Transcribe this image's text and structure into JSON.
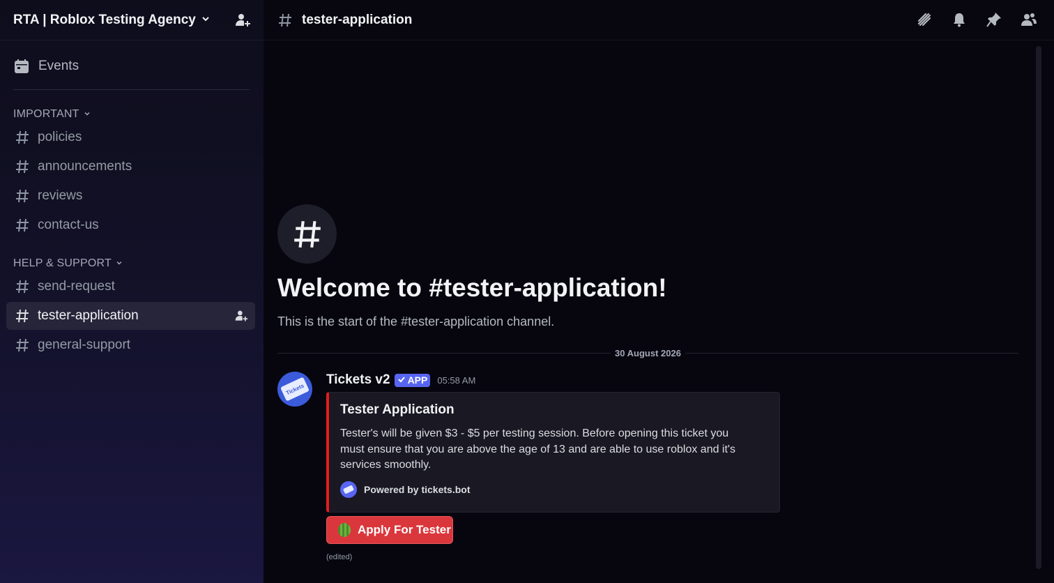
{
  "server": {
    "name": "RTA | Roblox Testing Agency"
  },
  "sidebar": {
    "events_label": "Events",
    "categories": [
      {
        "label": "IMPORTANT",
        "channels": [
          "policies",
          "announcements",
          "reviews",
          "contact-us"
        ]
      },
      {
        "label": "HELP & SUPPORT",
        "channels": [
          "send-request",
          "tester-application",
          "general-support"
        ]
      }
    ],
    "active_channel": "tester-application"
  },
  "topbar": {
    "channel_name": "tester-application",
    "icons": [
      "threads-icon",
      "bell-icon",
      "pin-icon",
      "member-list-icon"
    ]
  },
  "welcome": {
    "title": "Welcome to #tester-application!",
    "subtitle": "This is the start of the #tester-application channel."
  },
  "date_divider": "30 August 2026",
  "message": {
    "author": "Tickets v2",
    "badge": "APP",
    "timestamp": "05:58 AM",
    "avatar_text": "Tickets",
    "embed": {
      "accent_color": "#e01e1e",
      "title": "Tester Application",
      "description": "Tester's will be given $3 - $5 per testing session. Before opening this ticket you must ensure that you are above the age of 13 and are able to use roblox and it's services smoothly.",
      "footer": "Powered by tickets.bot"
    },
    "button": {
      "label": "Apply For Tester",
      "color": "#da373c"
    },
    "edited_label": "(edited)"
  }
}
